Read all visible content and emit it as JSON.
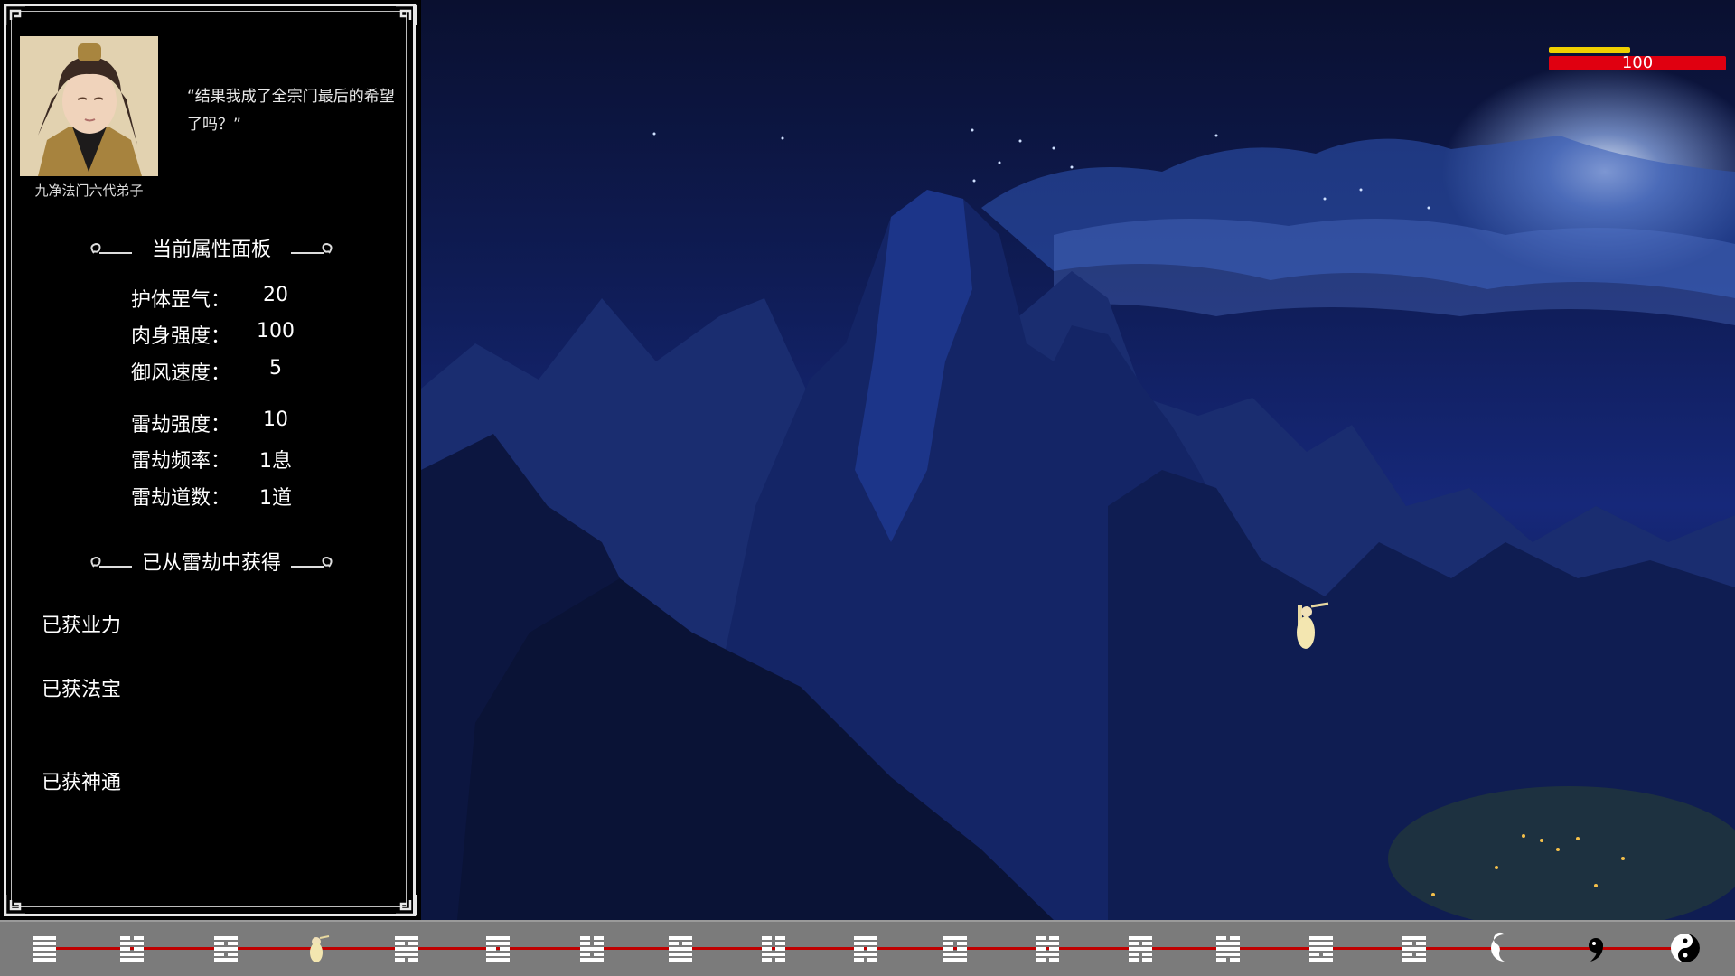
{
  "panel": {
    "quote": "“结果我成了全宗门最后的希望了吗？”",
    "character_title": "九净法门六代弟子",
    "attributes_header": "当前属性面板",
    "stats_group_1": [
      {
        "label": "护体罡气：",
        "value": "20"
      },
      {
        "label": "肉身强度：",
        "value": "100"
      },
      {
        "label": "御风速度：",
        "value": "5"
      }
    ],
    "stats_group_2": [
      {
        "label": "雷劫强度：",
        "value": "10"
      },
      {
        "label": "雷劫频率：",
        "value": "1息"
      },
      {
        "label": "雷劫道数：",
        "value": "1道"
      }
    ],
    "gains_header": "已从雷劫中获得",
    "gains": {
      "karma": "已获业力",
      "treasure": "已获法宝",
      "ability": "已获神通"
    }
  },
  "hud": {
    "hp_value": "100",
    "hp_fraction": 1.0,
    "shield_fraction": 0.46,
    "hp_color": "#e00010",
    "shield_color": "#f0d000"
  },
  "timeline": {
    "track_color": "#c00000",
    "slots": [
      {
        "icon": "trigram-qian-icon"
      },
      {
        "icon": "hexagram-icon"
      },
      {
        "icon": "hexagram-icon"
      },
      {
        "icon": "player-marker-icon"
      },
      {
        "icon": "hexagram-icon"
      },
      {
        "icon": "hexagram-icon"
      },
      {
        "icon": "hexagram-icon"
      },
      {
        "icon": "hexagram-icon"
      },
      {
        "icon": "hexagram-icon"
      },
      {
        "icon": "hexagram-icon"
      },
      {
        "icon": "hexagram-icon"
      },
      {
        "icon": "hexagram-icon"
      },
      {
        "icon": "hexagram-icon"
      },
      {
        "icon": "hexagram-icon"
      },
      {
        "icon": "hexagram-icon"
      },
      {
        "icon": "hexagram-icon"
      },
      {
        "icon": "yin-half-icon"
      },
      {
        "icon": "yang-dot-icon"
      },
      {
        "icon": "yin-yang-icon"
      }
    ]
  }
}
